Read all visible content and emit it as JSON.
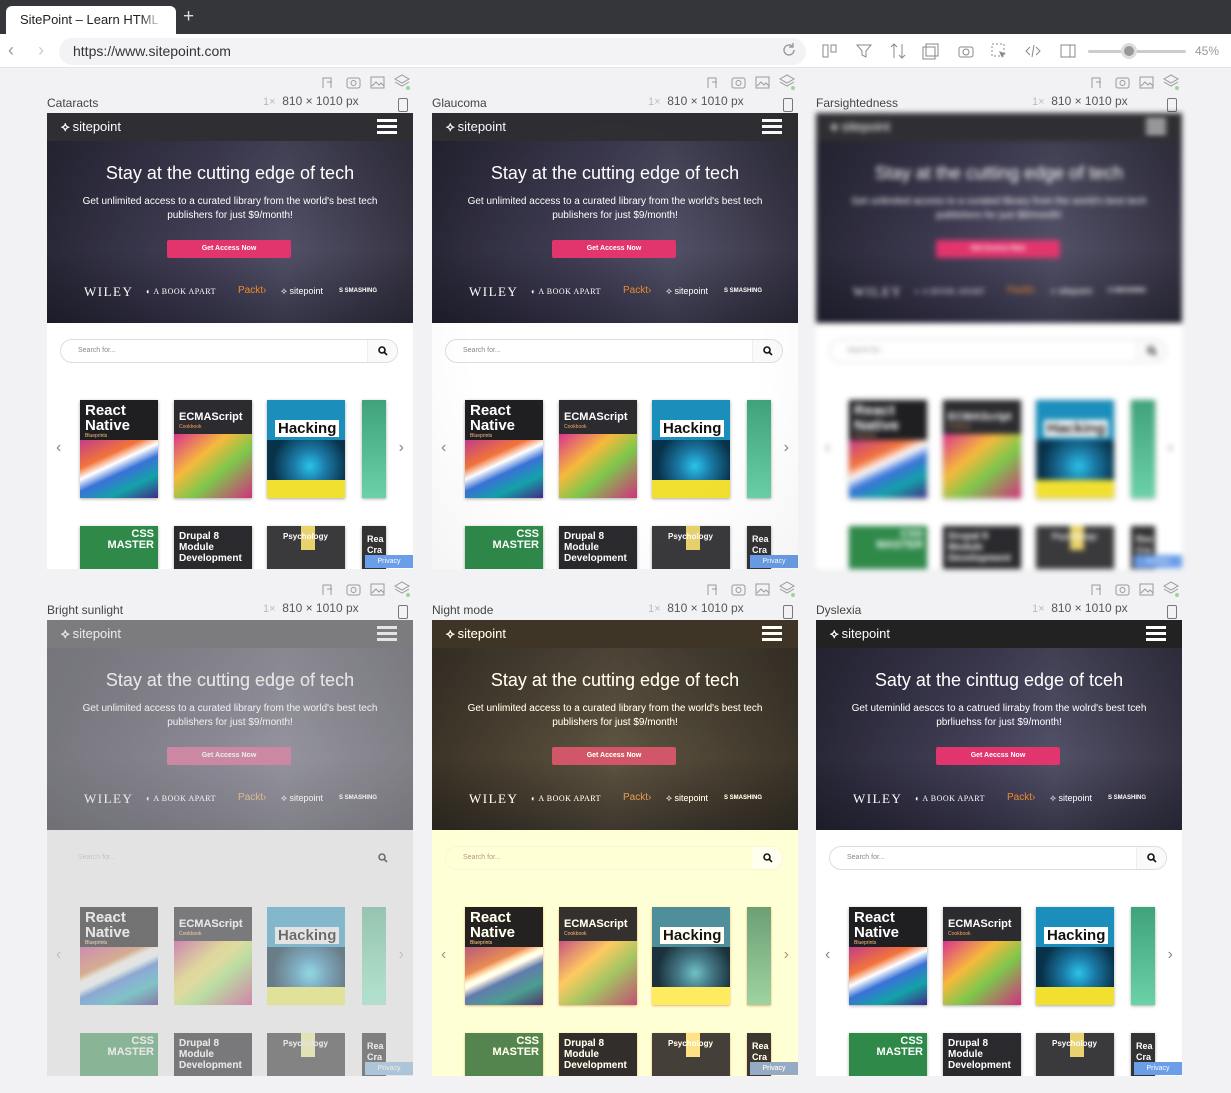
{
  "browser": {
    "tab_title": "SitePoint – Learn HTML",
    "new_tab": "+",
    "url": "https://www.sitepoint.com",
    "zoom": "45%",
    "toolbar_icons": [
      "back-icon",
      "forward-icon",
      "reload-icon",
      "layout-icon",
      "filter-icon",
      "sort-icon",
      "screenshot-list-icon",
      "camera-icon",
      "cursor-icon",
      "code-icon",
      "sidebar-icon"
    ],
    "zoom_level": 0.45
  },
  "panels": [
    {
      "label": "Cataracts",
      "scale": "1×",
      "size": "810 × 1010 px"
    },
    {
      "label": "Glaucoma",
      "scale": "1×",
      "size": "810 × 1010 px"
    },
    {
      "label": "Farsightedness",
      "scale": "1×",
      "size": "810 × 1010 px"
    },
    {
      "label": "Bright sunlight",
      "scale": "1×",
      "size": "810 × 1010 px"
    },
    {
      "label": "Night mode",
      "scale": "1×",
      "size": "810 × 1010 px"
    },
    {
      "label": "Dyslexia",
      "scale": "1×",
      "size": "810 × 1010 px"
    }
  ],
  "site": {
    "logo": "sitepoint",
    "hero_title": "Stay at the cutting edge of tech",
    "hero_sub": "Get unlimited access to a curated library from the world's best tech publishers for just $9/month!",
    "cta": "Get Access Now",
    "partners": {
      "wiley": "WILEY",
      "aba": "A BOOK APART",
      "packt": "Packt›",
      "sp": "sitepoint",
      "sm": "SMASHING"
    },
    "search_placeholder": "Search for...",
    "books": {
      "b1_title": "React Native",
      "b1_sub": "Blueprints",
      "b2_title": "ECMAScript",
      "b2_sub": "Cookbook",
      "b3_title": "Hacking",
      "r1_title": "CSS MASTER",
      "r2_title": "Drupal 8 Module Development",
      "r3_title": "Psychology",
      "r4_title": "Rea Cra"
    },
    "privacy": "Privacy"
  },
  "dyslexia": {
    "hero_title": "Saty at the cinttug edge of tceh",
    "hero_sub": "Get uteminlid aesccs to a catrued lirraby from the wolrd's best tceh pbrliuehss for just $9/month!",
    "cta": "Get Aeccss Now"
  }
}
